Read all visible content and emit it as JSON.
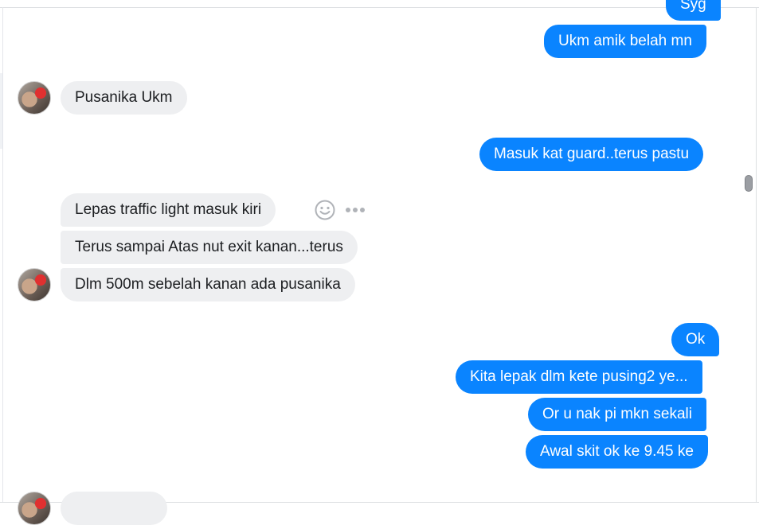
{
  "messages": {
    "m0": "Syg",
    "m1": "Ukm amik belah mn",
    "m2": "Pusanika Ukm",
    "m3": "Masuk kat guard..terus pastu",
    "m4": "Lepas traffic light masuk kiri",
    "m5": "Terus sampai Atas nut exit kanan...terus",
    "m6": "Dlm 500m sebelah kanan ada pusanika",
    "m7": "Ok",
    "m8": "Kita lepak dlm kete pusing2 ye...",
    "m9": "Or u nak pi mkn sekali",
    "m10": "Awal skit ok ke 9.45 ke"
  },
  "colors": {
    "outgoing_bubble": "#0a84ff",
    "incoming_bubble": "#eeeff1",
    "outgoing_text": "#ffffff",
    "incoming_text": "#1c1e21"
  },
  "icons": {
    "reaction": "smiley-icon",
    "more": "more-options-icon"
  }
}
